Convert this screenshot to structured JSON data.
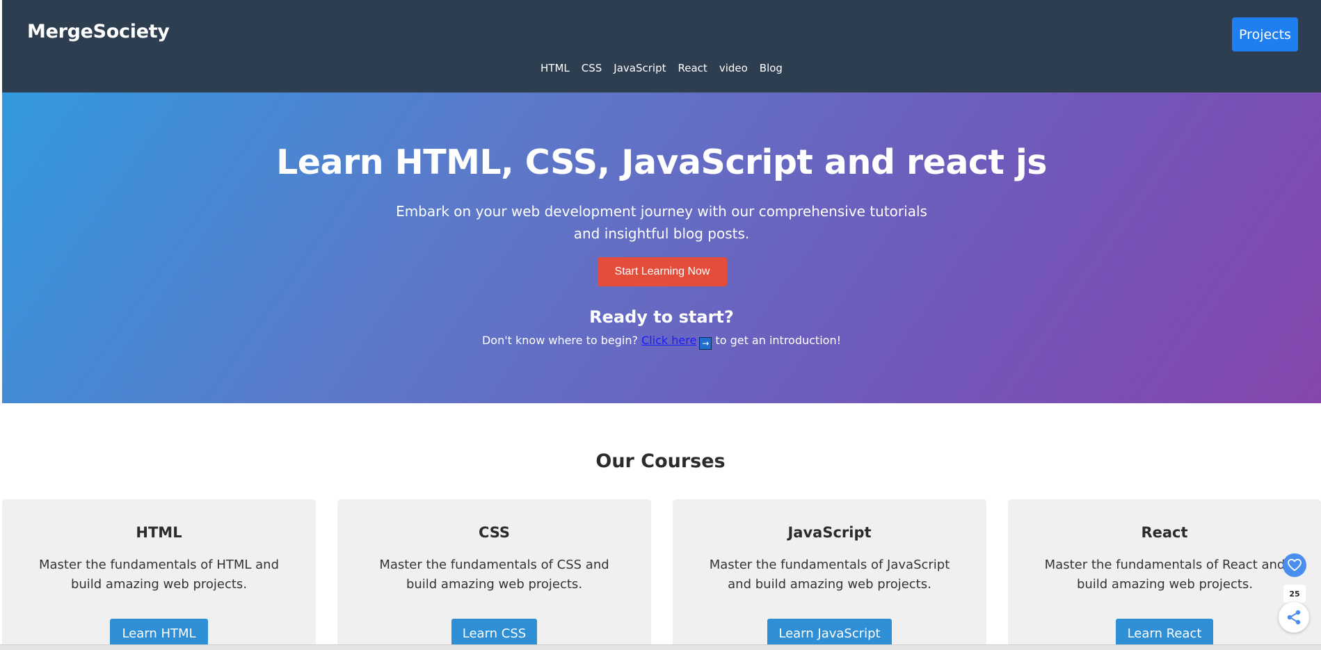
{
  "header": {
    "logo": "MergeSociety",
    "projects_label": "Projects",
    "nav": [
      "HTML",
      "CSS",
      "JavaScript",
      "React",
      "video",
      "Blog"
    ]
  },
  "hero": {
    "title": "Learn HTML, CSS, JavaScript and react js",
    "subtitle": "Embark on your web development journey with our comprehensive tutorials and insightful blog posts.",
    "cta_label": "Start Learning Now",
    "ready_title": "Ready to start?",
    "ready_prefix": "Don't know where to begin?",
    "ready_link": "Click here",
    "ready_arrow": "→",
    "ready_suffix": "to get an introduction!"
  },
  "courses": {
    "title": "Our Courses",
    "items": [
      {
        "title": "HTML",
        "desc": "Master the fundamentals of HTML and build amazing web projects.",
        "button": "Learn HTML"
      },
      {
        "title": "CSS",
        "desc": "Master the fundamentals of CSS and build amazing web projects.",
        "button": "Learn CSS"
      },
      {
        "title": "JavaScript",
        "desc": "Master the fundamentals of JavaScript and build amazing web projects.",
        "button": "Learn JavaScript"
      },
      {
        "title": "React",
        "desc": "Master the fundamentals of React and build amazing web projects.",
        "button": "Learn React"
      }
    ]
  },
  "widgets": {
    "like_count": "25",
    "heart_icon": "heart-icon",
    "share_icon": "share-icon"
  },
  "colors": {
    "header_bg": "#2e3e51",
    "projects_btn": "#1f7ff0",
    "cta_btn": "#e44d3a",
    "course_btn": "#2f8fd6",
    "card_bg": "#f0f0f0"
  }
}
